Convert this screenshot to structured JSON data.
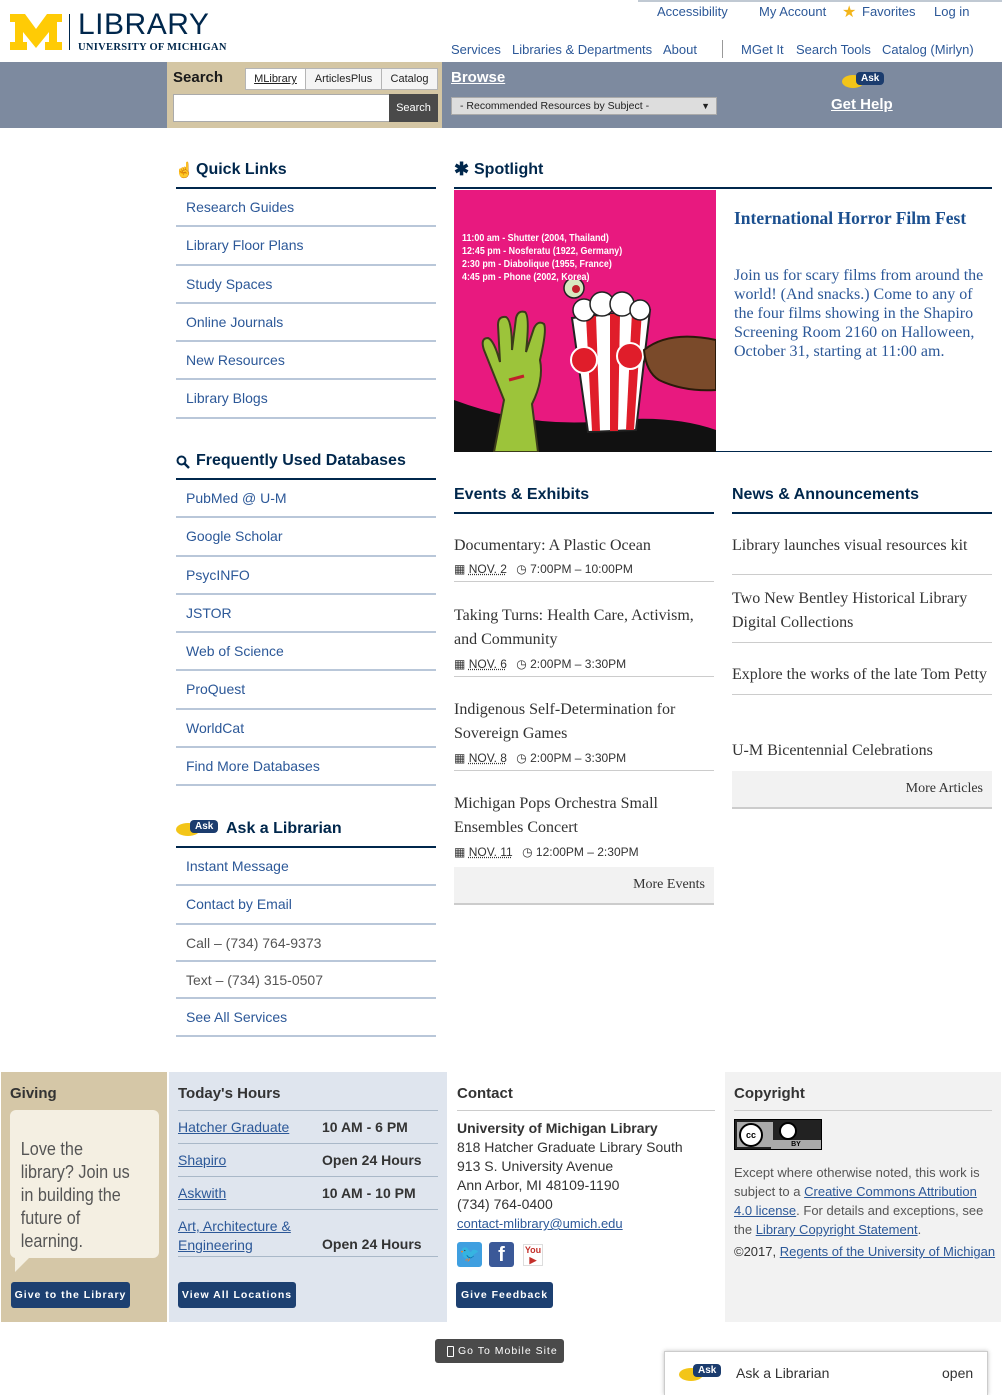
{
  "header": {
    "logo_title": "LIBRARY",
    "logo_subtitle": "UNIVERSITY OF MICHIGAN",
    "utility": [
      "Accessibility",
      "My Account",
      "Favorites",
      "Log in"
    ],
    "nav": [
      "Services",
      "Libraries & Departments",
      "About",
      "MGet It",
      "Search Tools",
      "Catalog (Mirlyn)"
    ]
  },
  "search": {
    "title": "Search",
    "tabs": [
      "MLibrary",
      "ArticlesPlus",
      "Catalog"
    ],
    "value": "",
    "button": "Search"
  },
  "browse": {
    "title": "Browse",
    "selected": "- Recommended Resources by Subject -"
  },
  "help": {
    "ask": "Ask",
    "label": "Get Help"
  },
  "quick_links": {
    "title": "Quick Links",
    "items": [
      "Research Guides",
      "Library Floor Plans",
      "Study Spaces",
      "Online Journals",
      "New Resources",
      "Library Blogs"
    ]
  },
  "databases": {
    "title": "Frequently Used Databases",
    "items": [
      "PubMed @ U-M",
      "Google Scholar",
      "PsycINFO",
      "JSTOR",
      "Web of Science",
      "ProQuest",
      "WorldCat",
      "Find More Databases"
    ]
  },
  "ask_librarian": {
    "title": "Ask a Librarian",
    "ask": "Ask",
    "items": [
      "Instant Message",
      "Contact by Email",
      "Call – (734) 764-9373",
      "Text – (734) 315-0507",
      "See All Services"
    ]
  },
  "spotlight": {
    "title": "Spotlight",
    "poster_lines": [
      "11:00 am - Shutter (2004, Thailand)",
      "12:45 pm - Nosferatu (1922, Germany)",
      "2:30 pm - Diabolique (1955, France)",
      "4:45 pm - Phone (2002, Korea)"
    ],
    "popcorn": "POP CORN",
    "headline": "International Horror Film Fest",
    "body": "Join us for scary films from around the world! (And snacks.) Come to any of the four films showing in the Shapiro Screening Room 2160 on Halloween, October 31, starting at 11:00 am."
  },
  "events": {
    "title": "Events & Exhibits",
    "items": [
      {
        "title": "Documentary: A Plastic Ocean",
        "date": "NOV. 2",
        "time": "7:00PM – 10:00PM"
      },
      {
        "title": "Taking Turns: Health Care, Activism, and Community",
        "date": "NOV. 6",
        "time": "2:00PM – 3:30PM"
      },
      {
        "title": "Indigenous Self-Determination for Sovereign Games",
        "date": "NOV. 8",
        "time": "2:00PM – 3:30PM"
      },
      {
        "title": "Michigan Pops Orchestra Small Ensembles Concert",
        "date": "NOV. 11",
        "time": "12:00PM – 2:30PM"
      }
    ],
    "more": "More Events"
  },
  "news": {
    "title": "News & Announcements",
    "items": [
      "Library launches visual resources kit",
      "Two New Bentley Historical Library Digital Collections",
      "Explore the works of the late Tom Petty",
      "U-M Bicentennial Celebrations"
    ],
    "more": "More Articles"
  },
  "footer": {
    "giving": {
      "title": "Giving",
      "quote": "Love the library? Join us in building the future of learning.",
      "button": "Give to the Library"
    },
    "hours": {
      "title": "Today's Hours",
      "rows": [
        {
          "name": "Hatcher Graduate",
          "time": "10 AM - 6 PM"
        },
        {
          "name": "Shapiro",
          "time": "Open 24 Hours"
        },
        {
          "name": "Askwith",
          "time": "10 AM - 10 PM"
        },
        {
          "name": "Art, Architecture & Engineering",
          "time": "Open 24 Hours"
        }
      ],
      "button": "View All Locations"
    },
    "contact": {
      "title": "Contact",
      "org": "University of Michigan Library",
      "lines": [
        "818 Hatcher Graduate Library South",
        "913 S. University Avenue",
        "Ann Arbor, MI 48109-1190",
        "(734) 764-0400"
      ],
      "email": "contact-mlibrary@umich.edu",
      "button": "Give Feedback"
    },
    "copyright": {
      "title": "Copyright",
      "badge": "cc BY",
      "text1": "Except where otherwise noted, this work is subject to a",
      "link1": "Creative Commons Attribution 4.0 license",
      "text2": ". For details and exceptions, see the",
      "link2": "Library Copyright Statement",
      "text3": ".",
      "year": "©2017,",
      "link3": "Regents of the University of Michigan"
    }
  },
  "mobile_button": "Go To Mobile Site",
  "chat": {
    "ask": "Ask",
    "label": "Ask a Librarian",
    "status": "open"
  }
}
